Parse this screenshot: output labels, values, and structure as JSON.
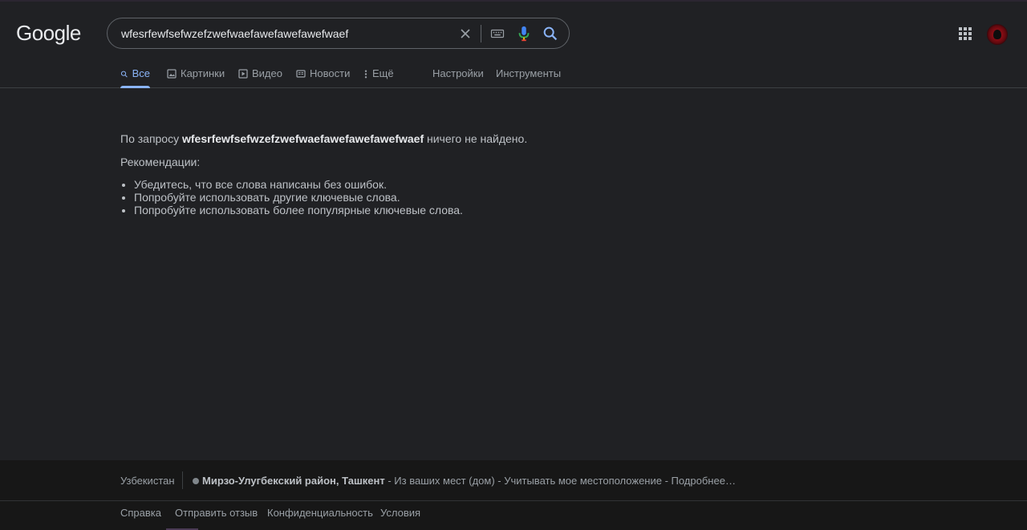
{
  "logo": "Google",
  "search": {
    "query": "wfesrfewfsefwzefzwefwaefawefawefawefwaef"
  },
  "tabs": [
    {
      "label": "Все",
      "active": true,
      "icon": "search-icon"
    },
    {
      "label": "Картинки",
      "active": false,
      "icon": "image-icon"
    },
    {
      "label": "Видео",
      "active": false,
      "icon": "video-icon"
    },
    {
      "label": "Новости",
      "active": false,
      "icon": "news-icon"
    },
    {
      "label": "Ещё",
      "active": false,
      "icon": "more-vert-icon"
    }
  ],
  "tools": {
    "settings": "Настройки",
    "tools": "Инструменты"
  },
  "results": {
    "prefix": "По запросу ",
    "query": "wfesrfewfsefwzefzwefwaefawefawefawefwaef",
    "suffix": " ничего не найдено.",
    "recs_title": "Рекомендации:",
    "recs": [
      "Убедитесь, что все слова написаны без ошибок.",
      "Попробуйте использовать другие ключевые слова.",
      "Попробуйте использовать более популярные ключевые слова."
    ]
  },
  "footer": {
    "country": "Узбекистан",
    "location": "Мирзо-Улугбекский район, Ташкент",
    "loc_source": " - Из ваших мест (дом) - ",
    "use_location": "Учитывать мое местоположение",
    "more": " - Подробнее…",
    "links": [
      "Справка",
      "Отправить отзыв",
      "Конфиденциальность",
      "Условия"
    ]
  },
  "colors": {
    "background": "#202124",
    "accent": "#8ab4f8",
    "text": "#bdc1c6",
    "footer_bg": "#171717"
  }
}
